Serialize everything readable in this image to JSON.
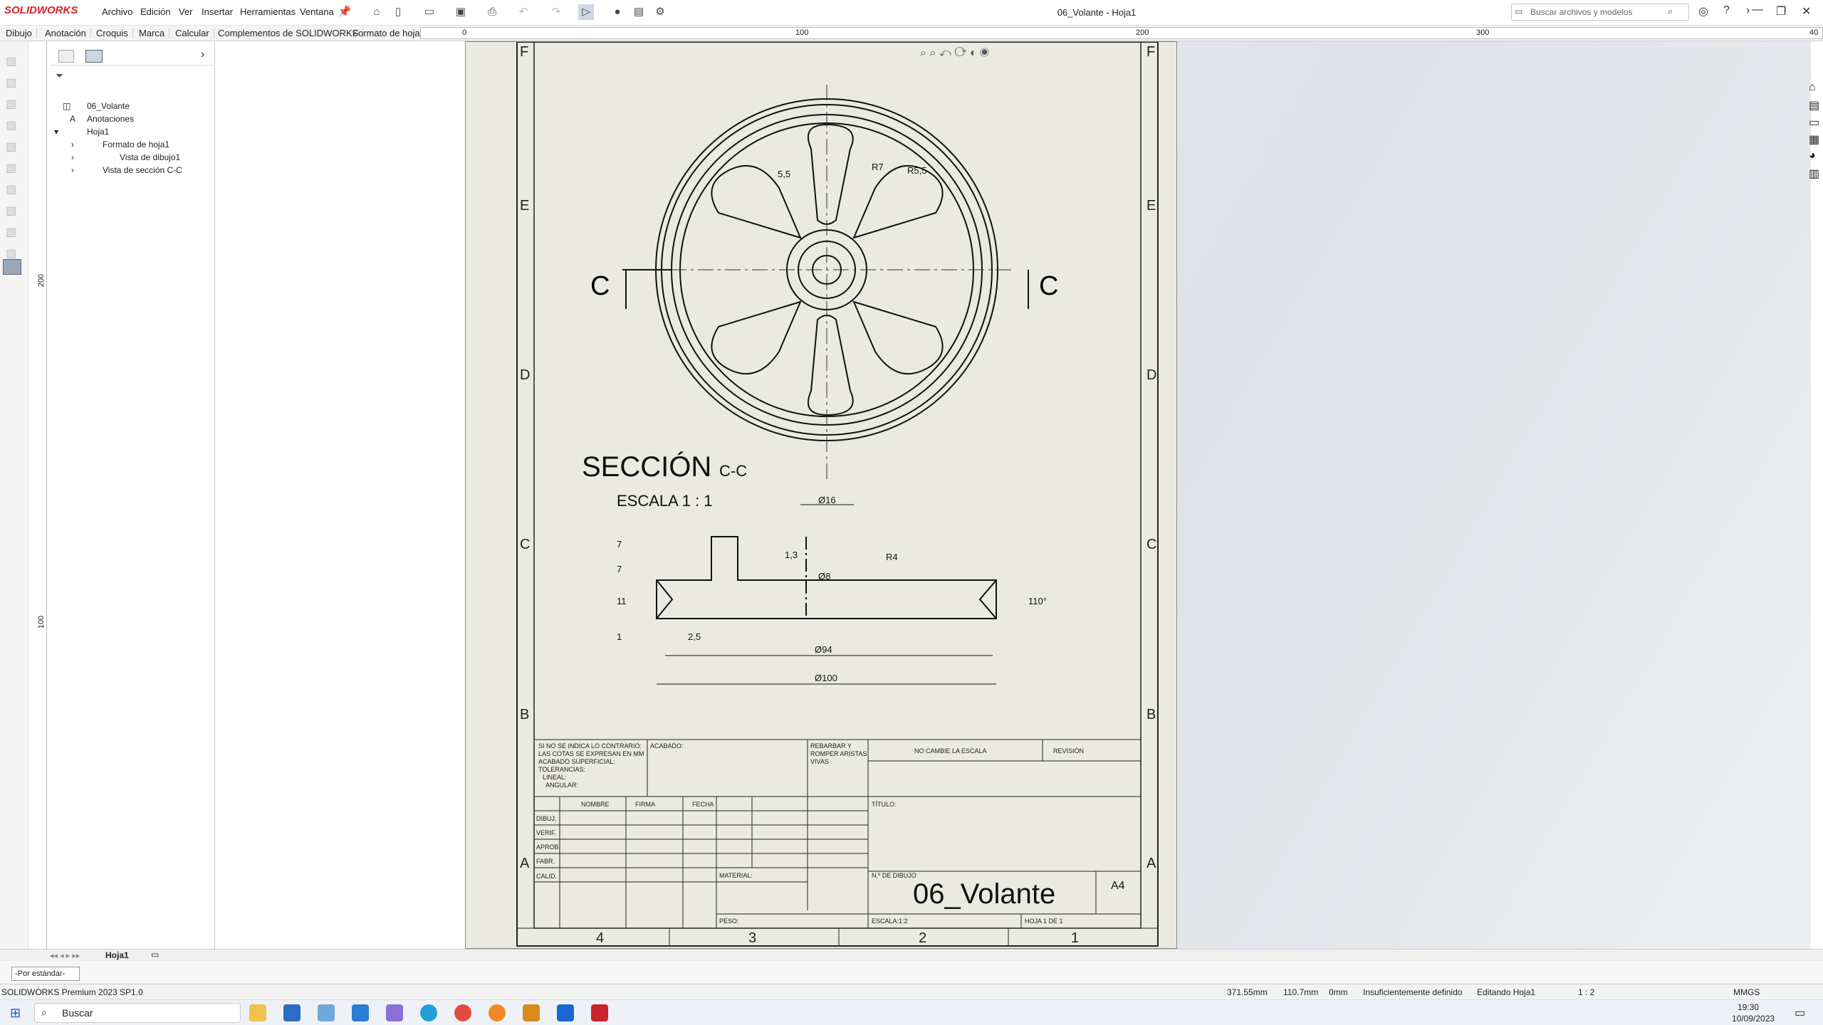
{
  "app": {
    "brand": "SOLIDWORKS",
    "window_title": "06_Volante - Hoja1",
    "menus": [
      "Archivo",
      "Edición",
      "Ver",
      "Insertar",
      "Herramientas",
      "Ventana"
    ],
    "search_placeholder": "Buscar archivos y modelos"
  },
  "command_tabs": [
    "Dibujo",
    "Anotación",
    "Croquis",
    "Marca",
    "Calcular",
    "Complementos de SOLIDWORKS",
    "Formato de hoja"
  ],
  "ruler_labels": [
    "0",
    "100",
    "200",
    "300",
    "40"
  ],
  "vruler_labels": [
    "200",
    "100"
  ],
  "tree": {
    "root": "06_Volante",
    "items": [
      "Anotaciones",
      "Hoja1",
      "Formato de hoja1",
      "Vista de dibujo1",
      "Vista de sección C-C"
    ]
  },
  "sheet": {
    "zone_letters": [
      "F",
      "E",
      "D",
      "C",
      "B",
      "A"
    ],
    "zone_numbers": [
      "4",
      "3",
      "2",
      "1"
    ],
    "section_letter": "C",
    "section_title": "SECCIÓN",
    "section_suffix": "C-C",
    "scale_label": "ESCALA  1 : 1",
    "top_dims": [
      "5,5",
      "R7",
      "R5,5"
    ],
    "section_dims": [
      "Ø16",
      "Ø8",
      "R4",
      "Ø94",
      "Ø100",
      "110°",
      "7",
      "7",
      "11",
      "1",
      "2,5",
      "1,3"
    ],
    "title_block": {
      "notes": [
        "SI NO SE INDICA LO CONTRARIO:",
        "LAS COTAS SE EXPRESAN EN MM",
        "ACABADO SUPERFICIAL:",
        "TOLERANCIAS:",
        "LINEAL:",
        "ANGULAR:"
      ],
      "acabado": "ACABADO:",
      "rebarbar": [
        "REBARBAR Y",
        "ROMPER ARISTAS",
        "VIVAS"
      ],
      "no_cambie": "NO CAMBIE LA ESCALA",
      "revision": "REVISIÓN",
      "headers": [
        "NOMBRE",
        "FIRMA",
        "FECHA"
      ],
      "rows": [
        "DIBUJ.",
        "VERIF.",
        "APROB.",
        "FABR.",
        "CALID."
      ],
      "titulo": "TÍTULO:",
      "material": "MATERIAL:",
      "n_dibujo": "N.º DE DIBUJO",
      "dwg_name": "06_Volante",
      "size": "A4",
      "peso": "PESO:",
      "escala": "ESCALA:1:2",
      "hoja": "HOJA 1 DE 1"
    }
  },
  "bottom": {
    "sheet_tab": "Hoja1",
    "combo": "-Por estándar-"
  },
  "status": {
    "product": "SOLIDWORKS Premium 2023 SP1.0",
    "x": "371.55mm",
    "y": "110.7mm",
    "z": "0mm",
    "state": "Insuficientemente definido",
    "editing": "Editando Hoja1",
    "scale": "1 : 2",
    "units": "MMGS"
  },
  "taskbar": {
    "search": "Buscar",
    "time": "19:30",
    "date": "10/09/2023"
  },
  "colors": {
    "accent": "#d2232a",
    "sheet": "#ebeadf"
  }
}
